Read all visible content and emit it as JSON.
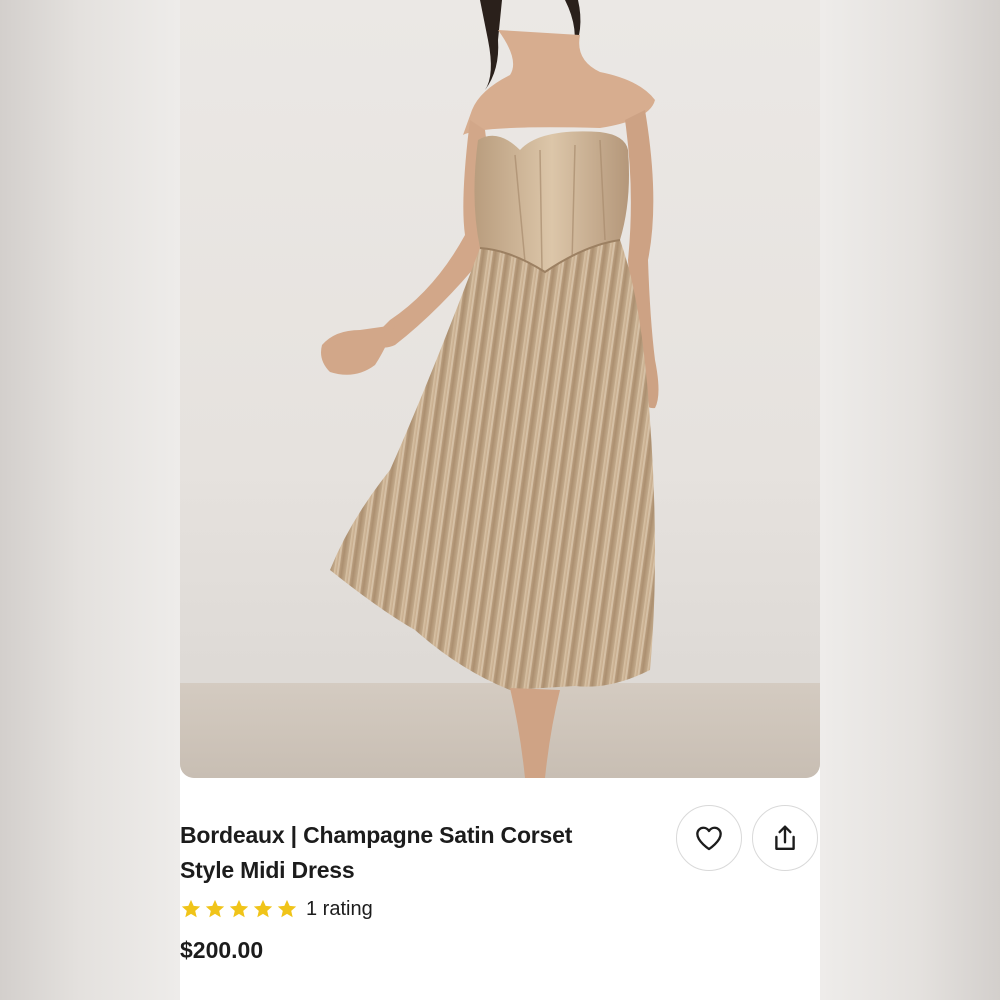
{
  "product": {
    "title_line1": "Bordeaux | Champagne Satin Corset",
    "title_line2": "Style Midi Dress",
    "rating_text": "1 rating",
    "stars": 5,
    "price": "$200.00"
  },
  "icons": {
    "like": "heart-icon",
    "share": "share-icon",
    "star": "star-icon"
  },
  "colors": {
    "star": "#f0c419",
    "text": "#1c1c1c",
    "dress": "#c9ae8d"
  }
}
